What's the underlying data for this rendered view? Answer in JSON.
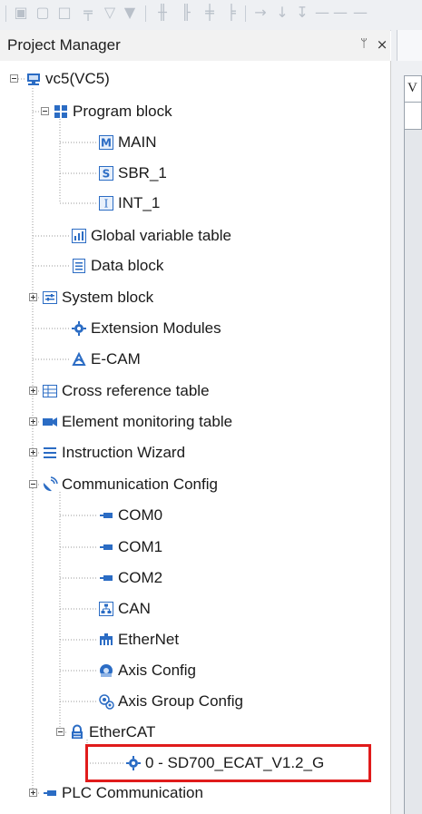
{
  "panel": {
    "title": "Project Manager",
    "pin_glyph": "📌",
    "close_glyph": "×"
  },
  "tree": {
    "root": "vc5(VC5)",
    "program_block": "Program block",
    "main": "MAIN",
    "sbr_1": "SBR_1",
    "int_1": "INT_1",
    "global_variable_table": "Global variable table",
    "data_block": "Data block",
    "system_block": "System block",
    "extension_modules": "Extension Modules",
    "ecam": "E-CAM",
    "cross_reference_table": "Cross reference table",
    "element_monitoring_table": "Element monitoring table",
    "instruction_wizard": "Instruction Wizard",
    "communication_config": "Communication Config",
    "com0": "COM0",
    "com1": "COM1",
    "com2": "COM2",
    "can": "CAN",
    "ethernet": "EtherNet",
    "axis_config": "Axis Config",
    "axis_group_config": "Axis Group Config",
    "ethercat": "EtherCAT",
    "ethercat_device": "0 - SD700_ECAT_V1.2_G",
    "plc_communication": "PLC Communication"
  },
  "right_panel": {
    "visible_text": "V"
  },
  "colors": {
    "highlight": "#e01b1b",
    "icon_blue": "#2b6cc4",
    "tree_line": "#9a9a9a"
  }
}
